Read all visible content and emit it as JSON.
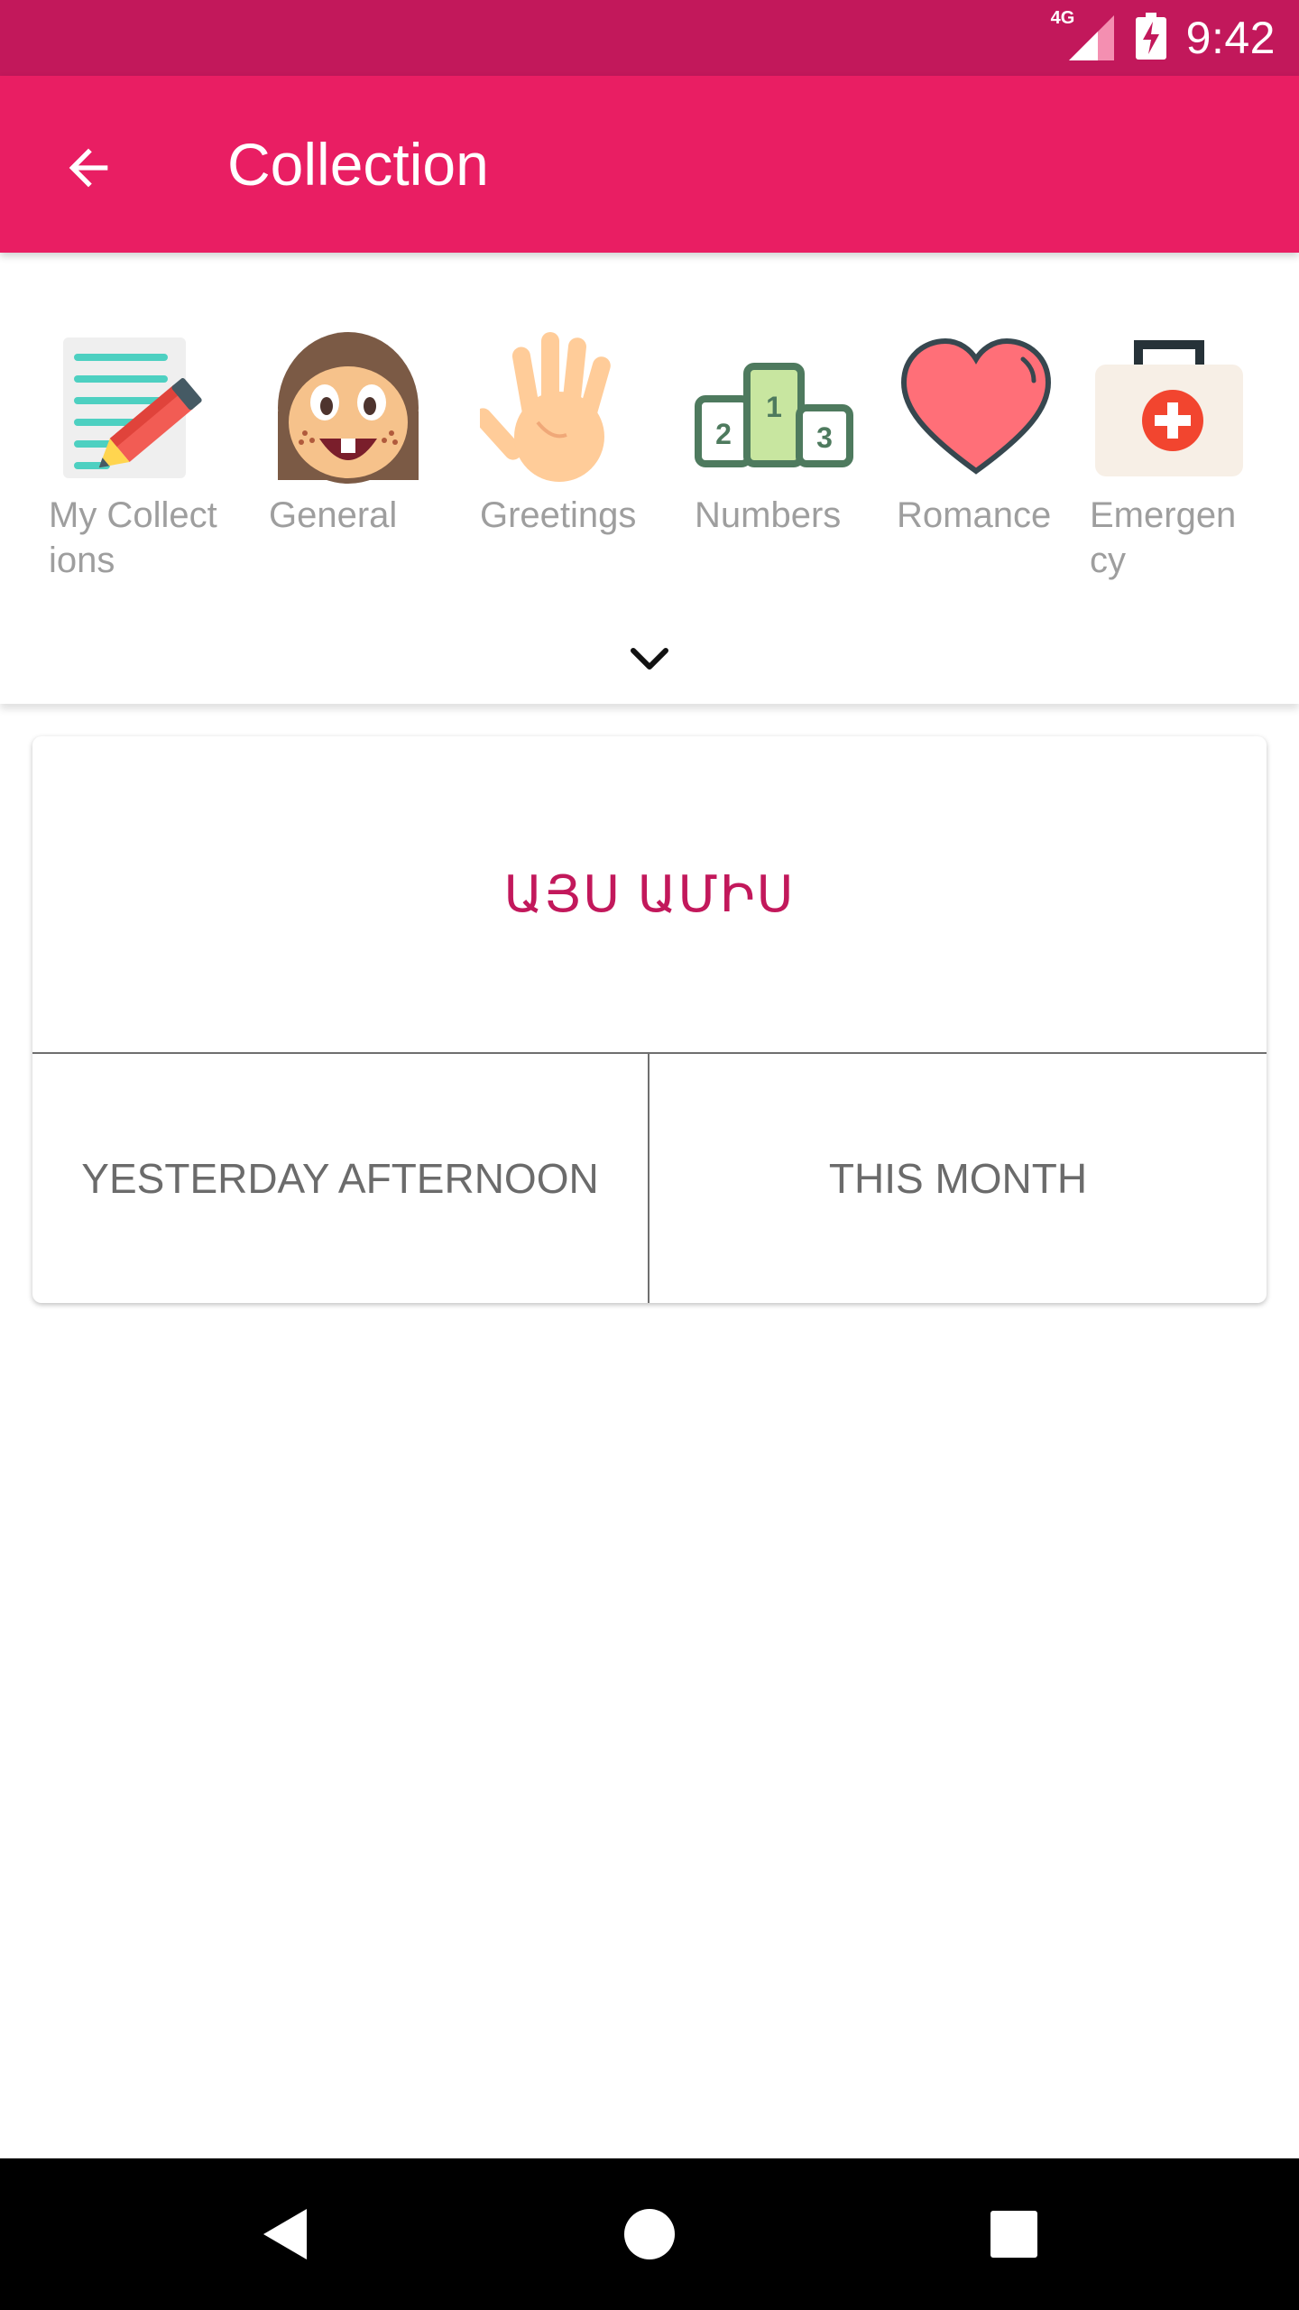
{
  "status_bar": {
    "time": "9:42",
    "network_label": "4G",
    "icons": [
      "signal-icon",
      "battery-charging-icon"
    ],
    "color": "#C2185B"
  },
  "app_bar": {
    "title": "Collection",
    "back_icon": "arrow-back-icon",
    "color": "#E91E63"
  },
  "categories": [
    {
      "label": "My Collect\nions",
      "icon": "notebook-pencil-icon"
    },
    {
      "label": "General",
      "icon": "smiling-face-icon"
    },
    {
      "label": "Greetings",
      "icon": "waving-hand-icon"
    },
    {
      "label": "Numbers",
      "icon": "podium-icon",
      "podium_digits": [
        "2",
        "1",
        "3"
      ]
    },
    {
      "label": "Romance",
      "icon": "heart-icon"
    },
    {
      "label": "Emergen\ncy",
      "icon": "first-aid-kit-icon"
    }
  ],
  "expand_icon": "chevron-down-icon",
  "card": {
    "prompt": "ԱՅՍ ԱՄԻՍ",
    "options": [
      "YESTERDAY AFTERNOON",
      "THIS MONTH"
    ],
    "accent": "#C2185B"
  },
  "nav_bar": {
    "icons": [
      "nav-back-icon",
      "nav-home-icon",
      "nav-recents-icon"
    ]
  }
}
